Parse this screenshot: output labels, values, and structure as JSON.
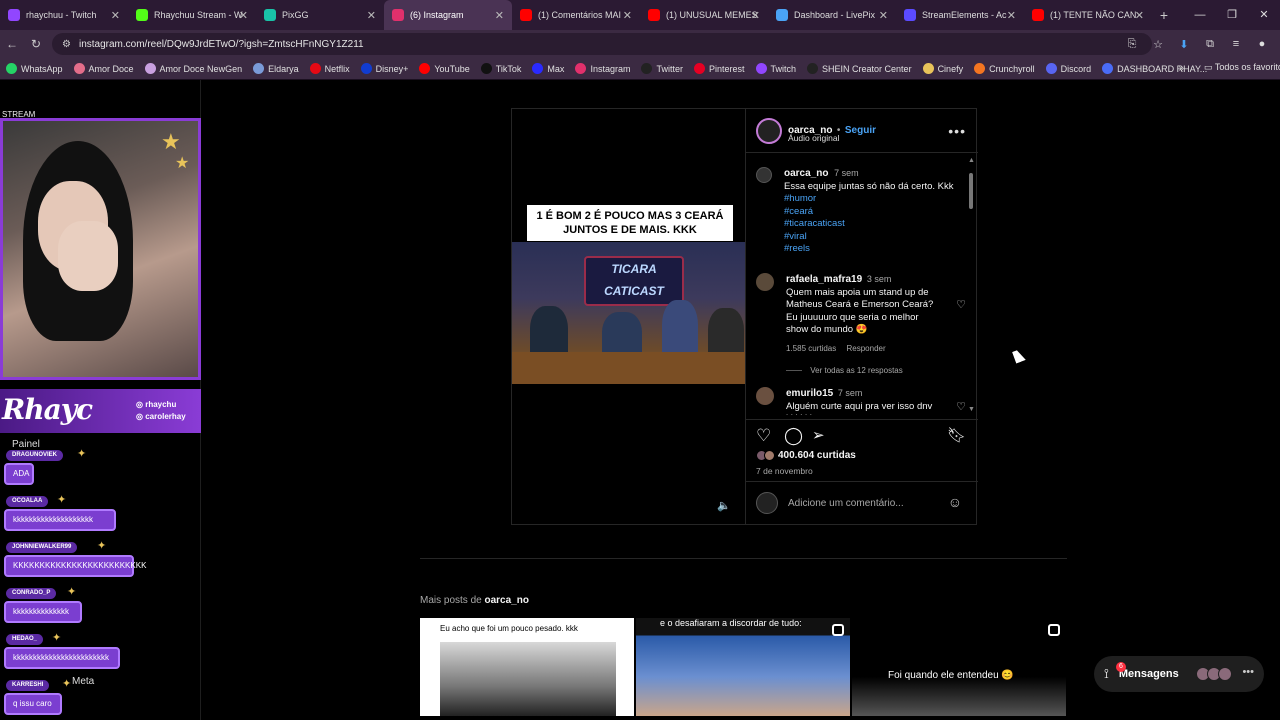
{
  "tabs": [
    {
      "label": "rhaychuu - Twitch",
      "fav_color": "#9146ff",
      "active": false
    },
    {
      "label": "Rhaychuu Stream - W",
      "fav_color": "#53fc18",
      "active": false
    },
    {
      "label": "PixGG",
      "fav_color": "#19c3a8",
      "active": false
    },
    {
      "label": "(6) Instagram",
      "fav_color": "#e1306c",
      "active": true
    },
    {
      "label": "(1) Comentários MAI",
      "fav_color": "#ff0000",
      "active": false
    },
    {
      "label": "(1) UNUSUAL MEMES",
      "fav_color": "#ff0000",
      "active": false
    },
    {
      "label": "Dashboard - LivePix",
      "fav_color": "#4aa3f5",
      "active": false
    },
    {
      "label": "StreamElements - Ac",
      "fav_color": "#5b4bff",
      "active": false
    },
    {
      "label": "(1) TENTE NÃO CAN",
      "fav_color": "#ff0000",
      "active": false
    }
  ],
  "address": {
    "url": "instagram.com/reel/DQw9JrdETwO/?igsh=ZmtscHFnNGY1Z211"
  },
  "bookmarks": [
    {
      "label": "WhatsApp",
      "color": "#25d366"
    },
    {
      "label": "Amor Doce",
      "color": "#e36d8a"
    },
    {
      "label": "Amor Doce NewGen",
      "color": "#c9a0e0"
    },
    {
      "label": "Eldarya",
      "color": "#7a9bd8"
    },
    {
      "label": "Netflix",
      "color": "#e50914"
    },
    {
      "label": "Disney+",
      "color": "#113ccf"
    },
    {
      "label": "YouTube",
      "color": "#ff0000"
    },
    {
      "label": "TikTok",
      "color": "#111111"
    },
    {
      "label": "Max",
      "color": "#2a2aff"
    },
    {
      "label": "Instagram",
      "color": "#e1306c"
    },
    {
      "label": "Twitter",
      "color": "#222222"
    },
    {
      "label": "Pinterest",
      "color": "#e60023"
    },
    {
      "label": "Twitch",
      "color": "#9146ff"
    },
    {
      "label": "SHEIN Creator Center",
      "color": "#222222"
    },
    {
      "label": "Cinefy",
      "color": "#e8c35a"
    },
    {
      "label": "Crunchyroll",
      "color": "#f47521"
    },
    {
      "label": "Discord",
      "color": "#5865f2"
    },
    {
      "label": "DASHBOARD RHAY...",
      "color": "#4a6cf7"
    }
  ],
  "bookmarks_folder": "Todos os favoritos",
  "overlay": {
    "stream_label": "STREAM",
    "logo": "Rhayc",
    "handle1": "◎ rhaychu",
    "handle2": "◎ carolerhay",
    "painel": "Painel",
    "meta": "Meta"
  },
  "chat": [
    {
      "name": "DRAGUNOVIEK",
      "msg": "ADA"
    },
    {
      "name": "OCOALAA",
      "msg": "kkkkkkkkkkkkkkkkkkkk"
    },
    {
      "name": "JOHNNIEWALKER99",
      "msg": "KKKKKKKKKKKKKKKKKKKKKKKKK"
    },
    {
      "name": "CONRADO_P",
      "msg": "kkkkkkkkkkkkkk"
    },
    {
      "name": "HEDAO_",
      "msg": "kkkkkkkkkkkkkkkkkkkkkkkk"
    },
    {
      "name": "KARRESHI",
      "msg": "q issu caro"
    }
  ],
  "reel": {
    "caption_overlay": "1 É BOM 2 É POUCO MAS 3 CEARÁ JUNTOS E DE MAIS. KKK",
    "sign_text": "TICARA CATICAST",
    "author": "oarca_no",
    "follow": "Seguir",
    "audio": "Áudio original",
    "post_time": "7 sem",
    "post_text": "Essa equipe juntas só não dá certo. Kkk",
    "hashtags": [
      "#humor",
      "#ceará",
      "#ticaracaticast",
      "#viral",
      "#reels"
    ],
    "comments": [
      {
        "user": "rafaela_mafra19",
        "time": "3 sem",
        "text": "Quem mais apoia um stand up de Matheus Ceará e Emerson Ceará? Eu juuuuuro que seria o melhor show do mundo 😍",
        "likes": "1.585 curtidas",
        "reply": "Responder",
        "view_replies": "Ver todas as 12 respostas"
      },
      {
        "user": "emurilo15",
        "time": "7 sem",
        "text": "Alguém curte aqui pra ver isso dnv kkkkkk"
      }
    ],
    "likes_count": "400.604 curtidas",
    "date": "7 de novembro",
    "add_comment_placeholder": "Adicione um comentário..."
  },
  "more_posts": {
    "label": "Mais posts de ",
    "author": "oarca_no"
  },
  "thumbs": [
    {
      "text": "Eu acho que foi um pouco pesado. kkk"
    },
    {
      "text": "e o desafiaram a discordar de tudo:"
    },
    {
      "text": "Foi quando ele entendeu 😊"
    }
  ],
  "messages": {
    "label": "Mensagens",
    "badge": "6"
  }
}
